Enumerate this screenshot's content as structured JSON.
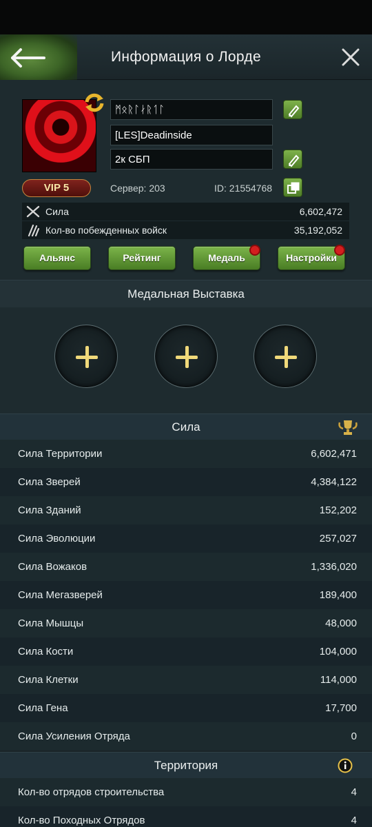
{
  "header": {
    "title": "Информация о Лорде"
  },
  "profile": {
    "name": "ᛗᛟᚱᛚᛅᚱᛐᛚ",
    "alliance_tag": "[LES]Deadinside",
    "signature": "2к СБП",
    "vip": "VIP 5",
    "server": "Сервер: 203",
    "id": "ID: 21554768"
  },
  "stats": [
    {
      "label": "Сила",
      "value": "6,602,472"
    },
    {
      "label": "Кол-во побежденных войск",
      "value": "35,192,052"
    }
  ],
  "buttons": {
    "alliance": "Альянс",
    "rating": "Рейтинг",
    "medal": "Медаль",
    "settings": "Настройки"
  },
  "medal_section": {
    "title": "Медальная Выставка"
  },
  "power_section": {
    "title": "Сила",
    "rows": [
      {
        "label": "Сила Территории",
        "value": "6,602,471"
      },
      {
        "label": "Сила Зверей",
        "value": "4,384,122"
      },
      {
        "label": "Сила Зданий",
        "value": "152,202"
      },
      {
        "label": "Сила Эволюции",
        "value": "257,027"
      },
      {
        "label": "Сила Вожаков",
        "value": "1,336,020"
      },
      {
        "label": "Сила Мегазверей",
        "value": "189,400"
      },
      {
        "label": "Сила Мышцы",
        "value": "48,000"
      },
      {
        "label": "Сила Кости",
        "value": "104,000"
      },
      {
        "label": "Сила Клетки",
        "value": "114,000"
      },
      {
        "label": "Сила Гена",
        "value": "17,700"
      },
      {
        "label": "Сила Усиления Отряда",
        "value": "0"
      }
    ]
  },
  "territory_section": {
    "title": "Территория",
    "rows": [
      {
        "label": "Кол-во отрядов строительства",
        "value": "4"
      },
      {
        "label": "Кол-во Походных Отрядов",
        "value": "4"
      }
    ]
  },
  "colors": {
    "accent_green": "#6fa33f",
    "gold": "#f0d97a",
    "badge_red": "#d41f1f"
  }
}
